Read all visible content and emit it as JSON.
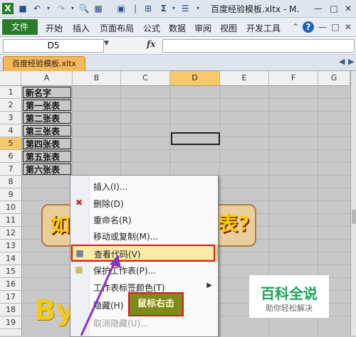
{
  "window": {
    "title": "百度经验模板.xltx - M.",
    "quick_access": [
      "save-icon",
      "undo-icon",
      "redo-icon",
      "print-preview-icon",
      "format-icon",
      "camera-icon",
      "border-icon",
      "sum-icon",
      "sort-icon",
      "customize-icon"
    ],
    "controls": [
      "minimize-icon",
      "restore-icon",
      "close-icon"
    ]
  },
  "ribbon": {
    "file_label": "文件",
    "tabs": [
      "开始",
      "插入",
      "页面布局",
      "公式",
      "数据",
      "审阅",
      "视图",
      "开发工具"
    ]
  },
  "formula_bar": {
    "name_box": "D5",
    "fx_label": "fx",
    "value": ""
  },
  "workbook_tab": "百度经验模板.xltx",
  "columns": [
    "A",
    "B",
    "C",
    "D",
    "E",
    "F",
    "G"
  ],
  "rows": [
    "1",
    "2",
    "3",
    "4",
    "5",
    "6",
    "7",
    "8",
    "9",
    "10",
    "11",
    "12",
    "13",
    "14",
    "15",
    "16",
    "17",
    "18",
    "19"
  ],
  "selected_cell": "D5",
  "cells_A": [
    "新名字",
    "第一张表",
    "第二张表",
    "第三张表",
    "第四张表",
    "第五张表",
    "第六张表"
  ],
  "banner": {
    "left": "如",
    "right": "表?"
  },
  "logo_text": "By",
  "context_menu": {
    "items": [
      {
        "label": "插入(I)...",
        "icon": "",
        "state": "normal"
      },
      {
        "label": "删除(D)",
        "icon": "delete-sheet-icon",
        "state": "normal"
      },
      {
        "label": "重命名(R)",
        "icon": "",
        "state": "normal"
      },
      {
        "label": "移动或复制(M)...",
        "icon": "",
        "state": "normal"
      },
      {
        "label": "查看代码(V)",
        "icon": "view-code-icon",
        "state": "highlighted"
      },
      {
        "label": "保护工作表(P)...",
        "icon": "protect-sheet-icon",
        "state": "normal"
      },
      {
        "label": "工作表标签颜色(T)",
        "icon": "",
        "state": "submenu"
      },
      {
        "label": "隐藏(H)",
        "icon": "",
        "state": "normal"
      },
      {
        "label": "取消隐藏(U)...",
        "icon": "",
        "state": "disabled"
      }
    ]
  },
  "callout": "鼠标右击",
  "watermark": {
    "title": "百科全说",
    "subtitle": "助你轻松解决"
  },
  "colors": {
    "file_tab": "#2a7b2a",
    "workbook_tab": "#f6b75a",
    "highlight_frame": "#e0141a",
    "callout_bg": "#7d8a1c",
    "arrow": "#8a32c8",
    "watermark_green": "#1aa35a"
  }
}
